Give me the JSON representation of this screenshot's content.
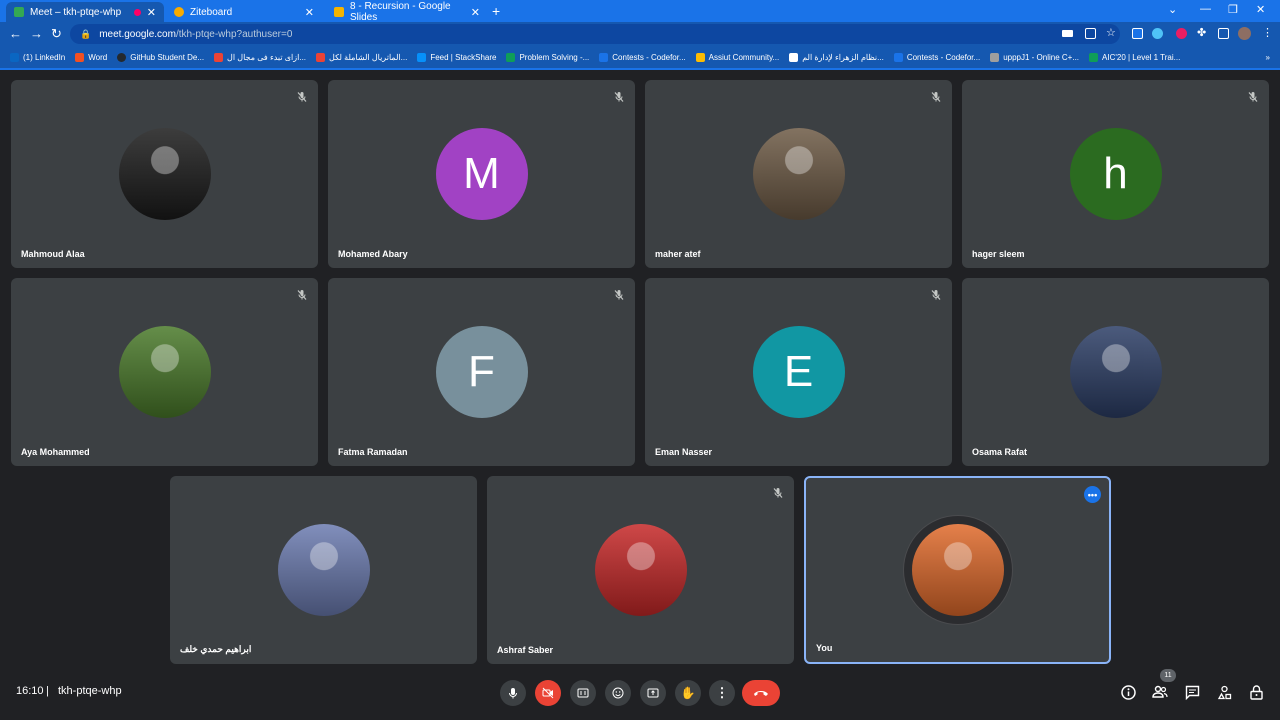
{
  "browser": {
    "tabs": [
      {
        "title": "Meet – tkh-ptqe-whp",
        "color": "#34a853"
      },
      {
        "title": "Ziteboard",
        "color": "#f9ab00"
      },
      {
        "title": "8 - Recursion - Google Slides",
        "color": "#f4b400"
      }
    ],
    "url_host": "meet.google.com",
    "url_path": "/tkh-ptqe-whp?authuser=0",
    "bookmarks": [
      {
        "label": "(1) LinkedIn",
        "color": "#0a66c2"
      },
      {
        "label": "Word",
        "color": "#2b579a"
      },
      {
        "label": "GitHub Student De...",
        "color": "#24292e"
      },
      {
        "label": "ازاى تبدء فى مجال ال...",
        "color": "#ea4335"
      },
      {
        "label": "الماتريال الشاملة لكل...",
        "color": "#ea4335"
      },
      {
        "label": "Feed | StackShare",
        "color": "#0690fa"
      },
      {
        "label": "Problem Solving -...",
        "color": "#0f9d58"
      },
      {
        "label": "Contests - Codefor...",
        "color": "#1a73e8"
      },
      {
        "label": "Assiut Community...",
        "color": "#fbbc04"
      },
      {
        "label": "نظام الزهراء لإدارة الم...",
        "color": "#ffffff"
      },
      {
        "label": "Contests - Codefor...",
        "color": "#1a73e8"
      },
      {
        "label": "upppJ1 - Online C+...",
        "color": "#9e9e9e"
      },
      {
        "label": "AIC'20 | Level 1 Trai...",
        "color": "#0f9d58"
      }
    ]
  },
  "participants": [
    {
      "name": "Mahmoud Alaa",
      "initial": "",
      "avatar_color": "#1b1b1b",
      "muted": true
    },
    {
      "name": "Mohamed Abary",
      "initial": "M",
      "avatar_color": "#a142c4",
      "muted": true
    },
    {
      "name": "maher atef",
      "initial": "",
      "avatar_color": "#6d5a45",
      "muted": true
    },
    {
      "name": "hager sleem",
      "initial": "h",
      "avatar_color": "#2b6b20",
      "muted": true
    },
    {
      "name": "Aya Mohammed",
      "initial": "",
      "avatar_color": "#4a7a2a",
      "muted": true
    },
    {
      "name": "Fatma Ramadan",
      "initial": "F",
      "avatar_color": "#78909c",
      "muted": true
    },
    {
      "name": "Eman Nasser",
      "initial": "E",
      "avatar_color": "#1197a3",
      "muted": true
    },
    {
      "name": "Osama Rafat",
      "initial": "",
      "avatar_color": "#2c3e66",
      "muted": false
    },
    {
      "name": "ابراهيم حمدي خلف",
      "initial": "",
      "avatar_color": "#6b7bb0",
      "muted": false
    },
    {
      "name": "Ashraf Saber",
      "initial": "",
      "avatar_color": "#c62828",
      "muted": true
    },
    {
      "name": "You",
      "initial": "",
      "avatar_color": "#e06a2b",
      "muted": false
    }
  ],
  "meeting": {
    "time": "16:10",
    "separator": "|",
    "code": "tkh-ptqe-whp",
    "participant_count": "11"
  },
  "controls": [
    "mic-icon",
    "camera-off-icon",
    "captions-icon",
    "emoji-icon",
    "present-icon",
    "raise-hand-icon",
    "more-options-icon",
    "leave-call-icon"
  ],
  "right_controls": [
    "info-icon",
    "people-icon",
    "chat-icon",
    "activities-icon",
    "host-controls-icon"
  ]
}
